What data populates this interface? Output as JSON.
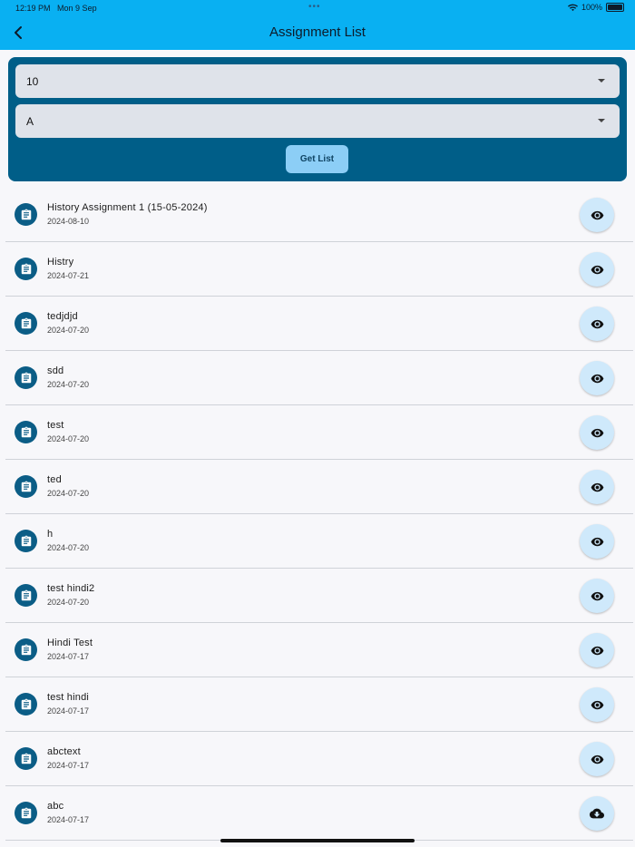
{
  "status": {
    "time": "12:19 PM",
    "date": "Mon 9 Sep",
    "dots": "•••",
    "battery": "100%"
  },
  "appbar": {
    "title": "Assignment List"
  },
  "filters": {
    "class_value": "10",
    "section_value": "A",
    "button_label": "Get List"
  },
  "colors": {
    "appbar": "#09b0f2",
    "panel": "#005e88",
    "leading_icon_bg": "#0b5d86",
    "action_bg": "#cfe9fb"
  },
  "assignments": [
    {
      "title": "History Assignment 1 (15-05-2024)",
      "date": "2024-08-10",
      "action": "eye-icon"
    },
    {
      "title": "Histry",
      "date": "2024-07-21",
      "action": "eye-icon"
    },
    {
      "title": "tedjdjd",
      "date": "2024-07-20",
      "action": "eye-icon"
    },
    {
      "title": "sdd",
      "date": "2024-07-20",
      "action": "eye-icon"
    },
    {
      "title": "test",
      "date": "2024-07-20",
      "action": "eye-icon"
    },
    {
      "title": "ted",
      "date": "2024-07-20",
      "action": "eye-icon"
    },
    {
      "title": "h",
      "date": "2024-07-20",
      "action": "eye-icon"
    },
    {
      "title": "test hindi2",
      "date": "2024-07-20",
      "action": "eye-icon"
    },
    {
      "title": "Hindi Test",
      "date": "2024-07-17",
      "action": "eye-icon"
    },
    {
      "title": "test hindi",
      "date": "2024-07-17",
      "action": "eye-icon"
    },
    {
      "title": "abctext",
      "date": "2024-07-17",
      "action": "eye-icon"
    },
    {
      "title": "abc",
      "date": "2024-07-17",
      "action": "cloud-download-icon"
    }
  ]
}
